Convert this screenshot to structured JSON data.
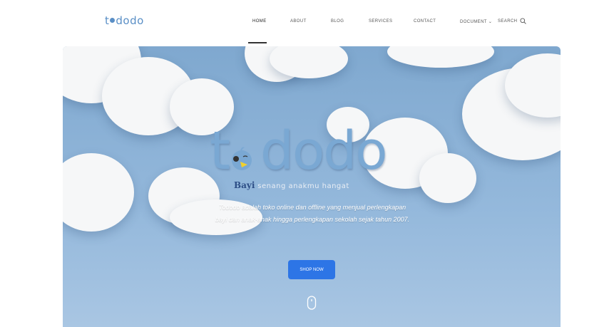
{
  "logo": {
    "text_pre": "t",
    "text_post": "dodo"
  },
  "nav": {
    "items": [
      {
        "label": "HOME"
      },
      {
        "label": "ABOUT"
      },
      {
        "label": "BLOG"
      },
      {
        "label": "SERVICES"
      },
      {
        "label": "CONTACT"
      },
      {
        "label": "DOCUMENT"
      }
    ],
    "search_label": "SEARCH"
  },
  "hero": {
    "logo_pre": "t",
    "logo_post": "dodo",
    "tagline_bold": "Bayi",
    "tagline_light": "senang anakmu hangat",
    "description": "Tododo adalah toko online dan offline yang menjual perlengkapan bayi dan anak-anak hingga perlengkapan sekolah sejak tahun 2007.",
    "cta_label": "SHOP NOW"
  },
  "colors": {
    "accent": "#2d75e6",
    "logo": "#5a8fc6",
    "sky": "#8fb3d8"
  },
  "icons": {
    "search": "search-icon",
    "scroll": "mouse-scroll-icon",
    "dropdown": "chevron-down-icon"
  }
}
